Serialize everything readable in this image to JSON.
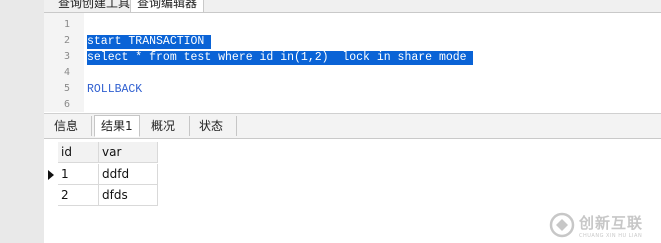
{
  "top_tabs": [
    {
      "label": "查询创建工具"
    },
    {
      "label": "查询编辑器"
    }
  ],
  "editor": {
    "lines": [
      {
        "num": "1",
        "text": ""
      },
      {
        "num": "2",
        "text": "start TRANSACTION "
      },
      {
        "num": "3",
        "text": "select * from test where id in(1,2)  lock in share mode "
      },
      {
        "num": "4",
        "text": ""
      },
      {
        "num": "5",
        "text": "ROLLBACK"
      },
      {
        "num": "6",
        "text": ""
      }
    ]
  },
  "result_tabs": [
    {
      "label": "信息"
    },
    {
      "label": "结果1"
    },
    {
      "label": "概况"
    },
    {
      "label": "状态"
    }
  ],
  "grid": {
    "columns": [
      "id",
      "var"
    ],
    "rows": [
      [
        "1",
        "ddfd"
      ],
      [
        "2",
        "dfds"
      ]
    ]
  },
  "watermark": {
    "text": "创新互联",
    "sub": "CHUANG XIN HU LIAN"
  },
  "colors": {
    "selection": "#0a63d6",
    "keyword": "#2f5fd0"
  }
}
